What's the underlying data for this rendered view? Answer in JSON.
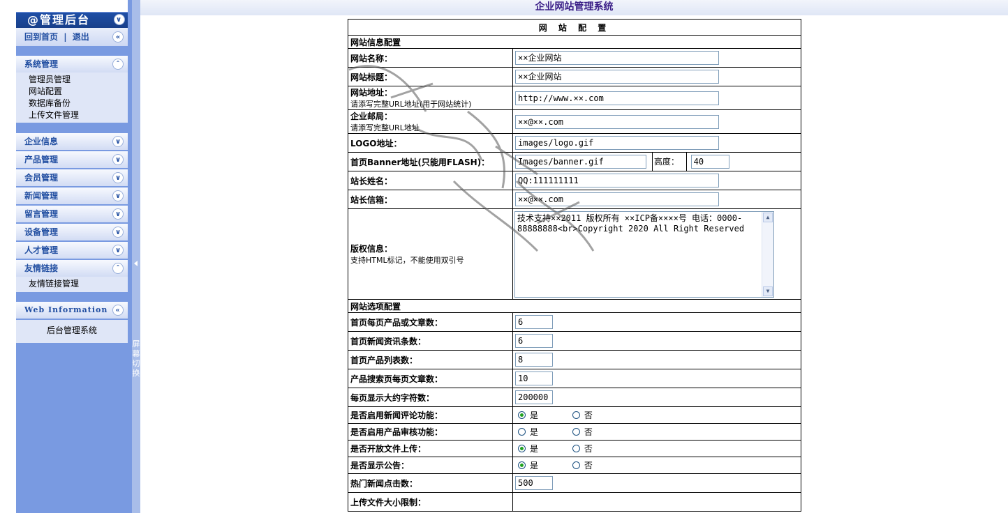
{
  "window_title": "企业网站管理系统",
  "splitter": {
    "label": "屏幕切换"
  },
  "sidebar": {
    "header": "@管理后台",
    "quick_links": {
      "home": "回到首页",
      "sep": "|",
      "logout": "退出"
    },
    "menus": [
      {
        "title": "系统管理",
        "expanded": true,
        "items": [
          "管理员管理",
          "网站配置",
          "数据库备份",
          "上传文件管理"
        ]
      },
      {
        "title": "企业信息",
        "expanded": false,
        "items": []
      },
      {
        "title": "产品管理",
        "expanded": false,
        "items": []
      },
      {
        "title": "会员管理",
        "expanded": false,
        "items": []
      },
      {
        "title": "新闻管理",
        "expanded": false,
        "items": []
      },
      {
        "title": "留言管理",
        "expanded": false,
        "items": []
      },
      {
        "title": "设备管理",
        "expanded": false,
        "items": []
      },
      {
        "title": "人才管理",
        "expanded": false,
        "items": []
      },
      {
        "title": "友情链接",
        "expanded": true,
        "items": [
          "友情链接管理"
        ]
      }
    ],
    "web_info": {
      "title": "Web Information",
      "body": "后台管理系统"
    }
  },
  "config": {
    "caption": "网 站 配 置",
    "section_site": "网站信息配置",
    "site_name": {
      "label": "网站名称：",
      "value": "××企业网站"
    },
    "site_title": {
      "label": "网站标题：",
      "value": "××企业网站"
    },
    "site_url": {
      "label": "网站地址：",
      "hint": "请添写完整URL地址(用于网站统计)",
      "value": "http://www.××.com"
    },
    "email": {
      "label": "企业邮局：",
      "hint": "请添写完整URL地址",
      "value": "××@××.com"
    },
    "logo": {
      "label": "LOGO地址：",
      "value": "images/logo.gif"
    },
    "banner": {
      "label": "首页Banner地址(只能用FLASH)：",
      "value": "Images/banner.gif",
      "height_label": "高度：",
      "height_value": "40"
    },
    "owner_name": {
      "label": "站长姓名：",
      "value": "QQ:111111111"
    },
    "owner_email": {
      "label": "站长信箱：",
      "value": "××@××.com"
    },
    "copyright": {
      "label": "版权信息：",
      "hint": "支持HTML标记，不能使用双引号",
      "value": "技术支持××2011 版权所有 ××ICP备××××号 电话：0000-88888888<br>Copyright 2020 All Right Reserved"
    },
    "section_options": "网站选项配置",
    "options": [
      {
        "label": "首页每页产品或文章数：",
        "value": "6"
      },
      {
        "label": "首页新闻资讯条数：",
        "value": "6"
      },
      {
        "label": "首页产品列表数：",
        "value": "8"
      },
      {
        "label": "产品搜索页每页文章数：",
        "value": "10"
      },
      {
        "label": "每页显示大约字符数：",
        "value": "200000"
      }
    ],
    "radios": [
      {
        "label": "是否启用新闻评论功能：",
        "yes": "是",
        "no": "否",
        "selected": "yes"
      },
      {
        "label": "是否启用产品审核功能：",
        "yes": "是",
        "no": "否",
        "selected": "none"
      },
      {
        "label": "是否开放文件上传：",
        "yes": "是",
        "no": "否",
        "selected": "yes"
      },
      {
        "label": "是否显示公告：",
        "yes": "是",
        "no": "否",
        "selected": "yes"
      }
    ],
    "hot_news": {
      "label": "热门新闻点击数：",
      "value": "500"
    },
    "upload_limit": {
      "label": "上传文件大小限制："
    }
  }
}
